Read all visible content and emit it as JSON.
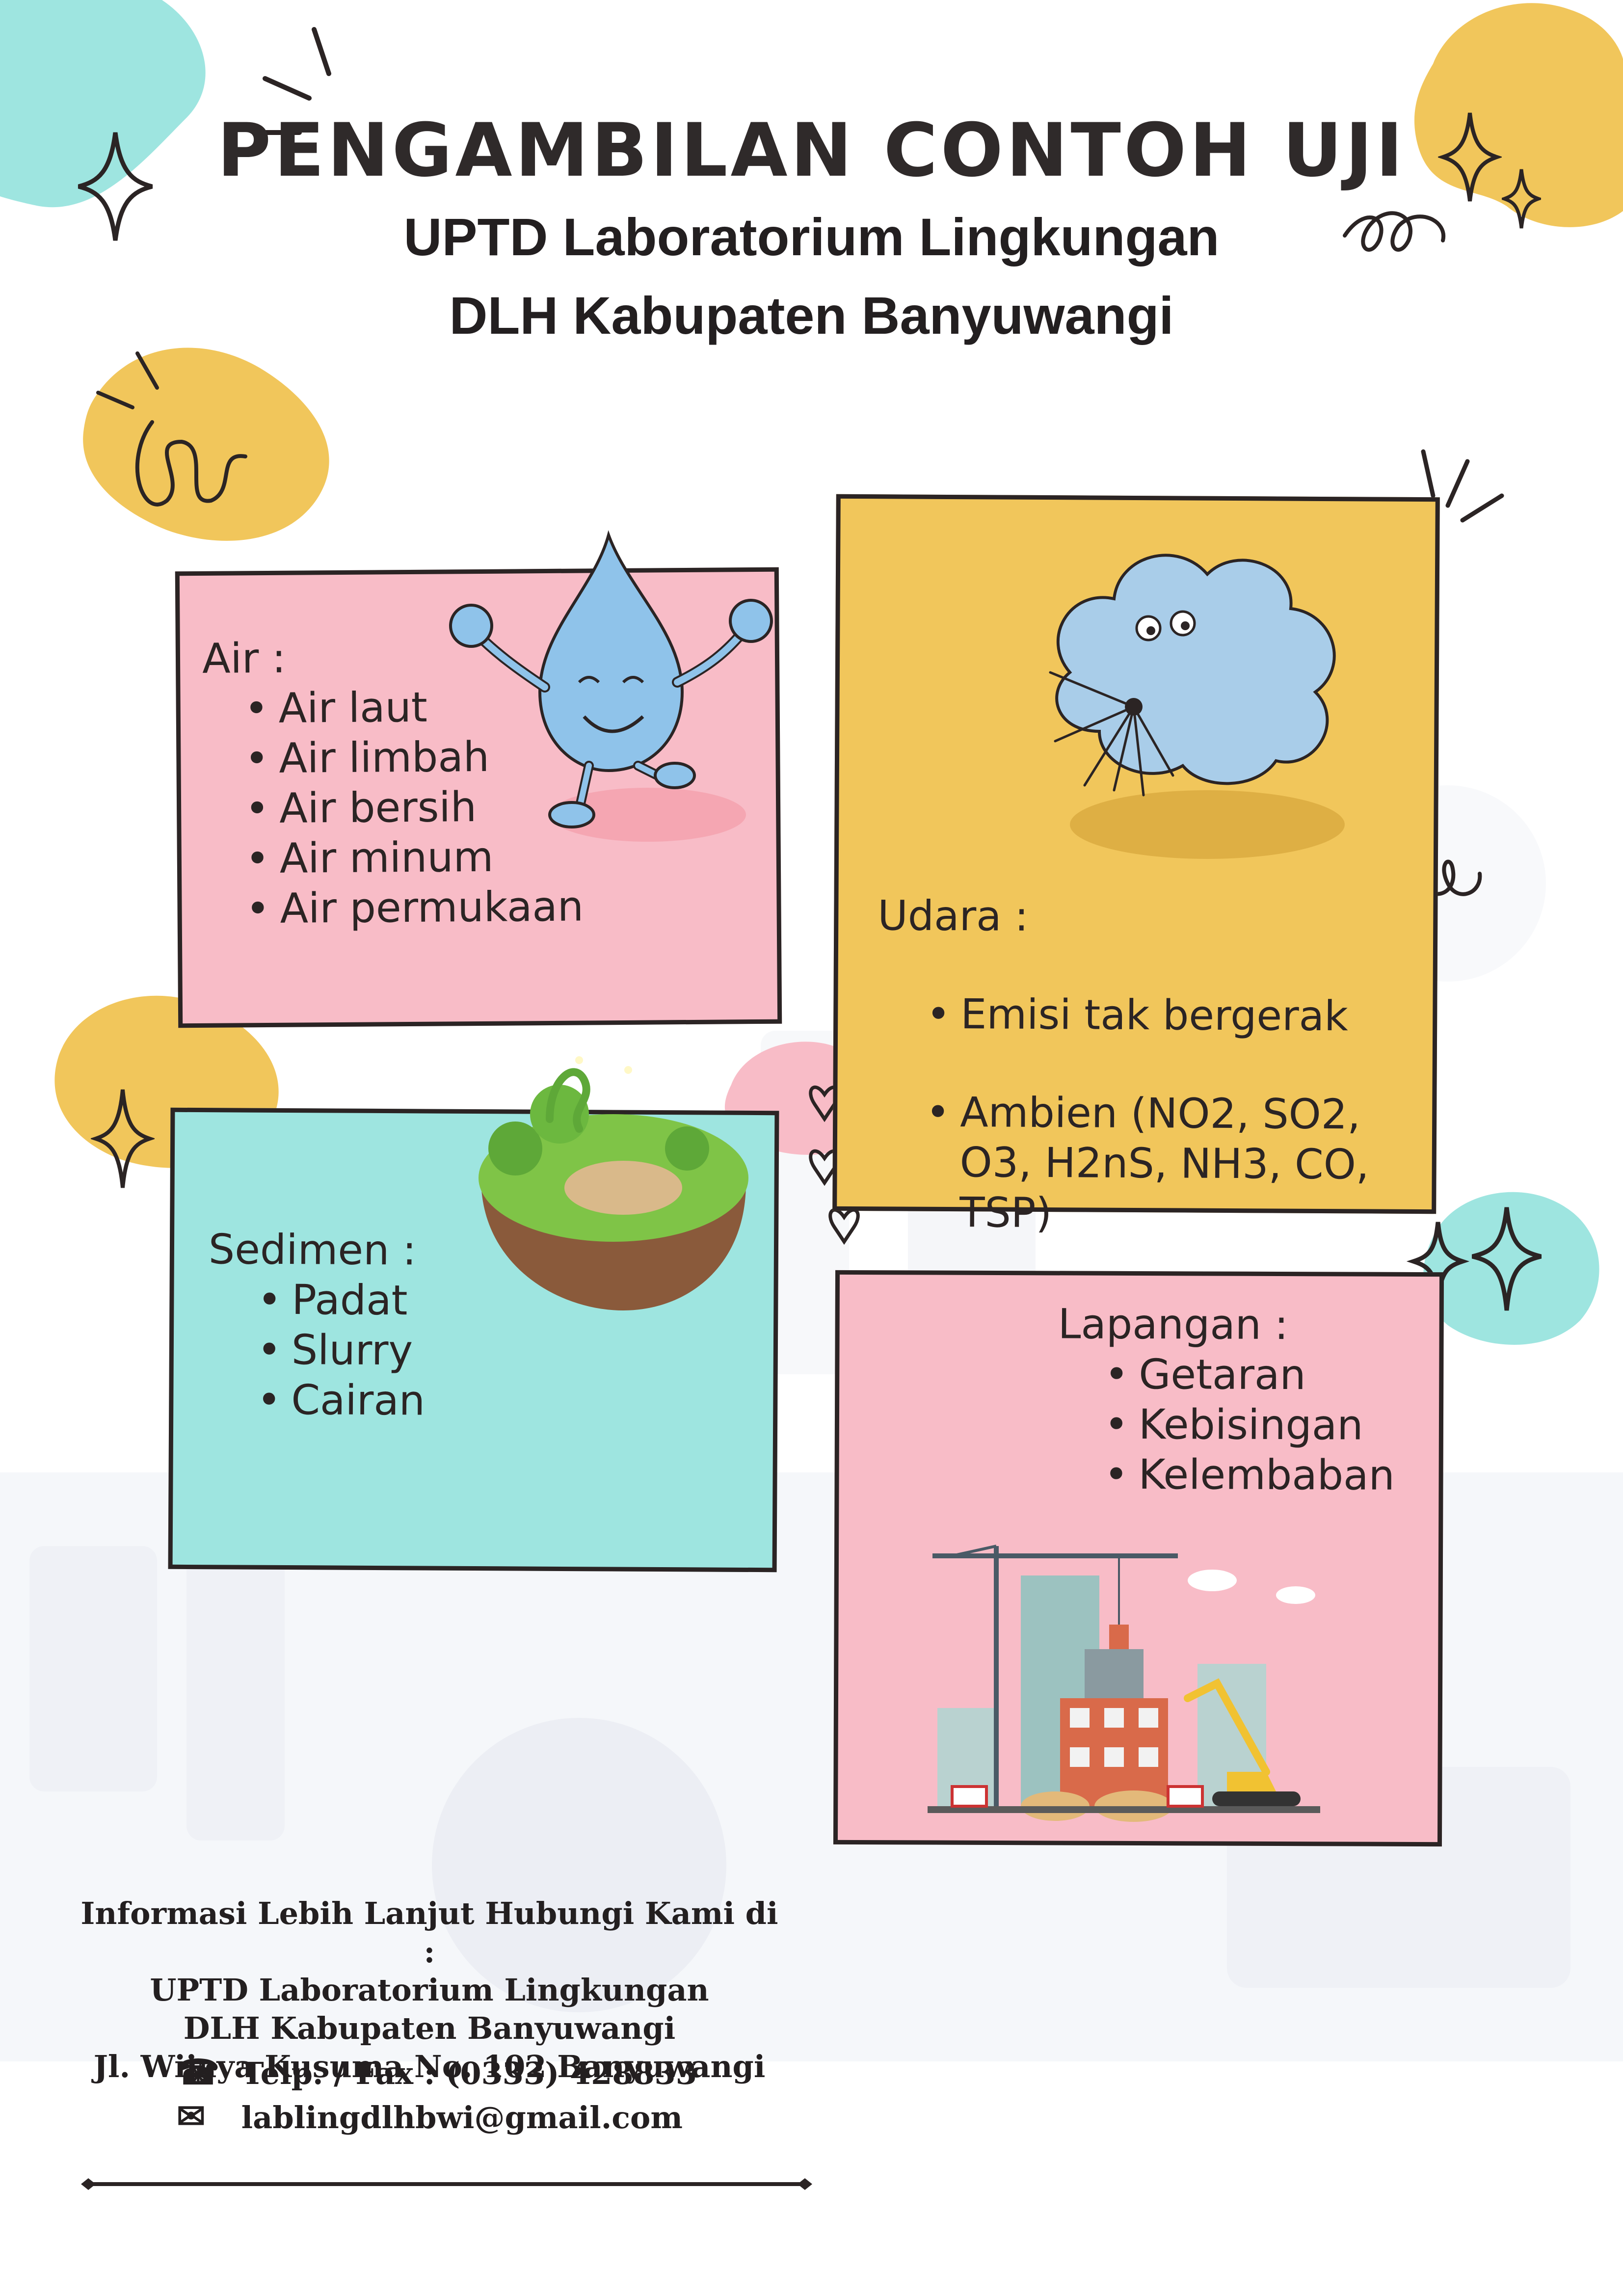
{
  "header": {
    "title": "PENGAMBILAN CONTOH UJI",
    "subtitle_line1": "UPTD Laboratorium Lingkungan",
    "subtitle_line2": "DLH Kabupaten Banyuwangi"
  },
  "cards": {
    "air": {
      "heading": "Air :",
      "items": [
        "Air laut",
        "Air limbah",
        "Air bersih",
        "Air minum",
        "Air permukaan"
      ],
      "color": "#f8bcc7",
      "icon": "water-drop-icon"
    },
    "udara": {
      "heading": "Udara  :",
      "items": [
        "Emisi tak bergerak",
        "Ambien (NO2, SO2,\nO3, H2nS, NH3, CO,\nTSP)"
      ],
      "color": "#f1c65b",
      "icon": "cloud-face-icon"
    },
    "sedimen": {
      "heading": "Sedimen :",
      "items": [
        "Padat",
        "Slurry",
        "Cairan"
      ],
      "color": "#9ee5e0",
      "icon": "floating-island-icon"
    },
    "lapangan": {
      "heading": "Lapangan :",
      "items": [
        "Getaran",
        "Kebisingan",
        "Kelembaban"
      ],
      "color": "#f8bcc7",
      "icon": "construction-site-icon"
    }
  },
  "footer": {
    "line1": "Informasi Lebih Lanjut Hubungi Kami di :",
    "line2": "UPTD Laboratorium Lingkungan",
    "line3": "DLH Kabupaten Banyuwangi",
    "line4": "Jl. Wijaya Kusuma No. 102 Banyuwangi",
    "phone": "Telp. / Fax : (0333) 428833",
    "email": "lablingdlhbwi@gmail.com",
    "phone_icon": "phone-icon",
    "email_icon": "envelope-icon"
  },
  "colors": {
    "pink": "#f8bcc7",
    "yellow": "#f1c65b",
    "teal": "#9ee5e0",
    "ink": "#2b2424"
  }
}
